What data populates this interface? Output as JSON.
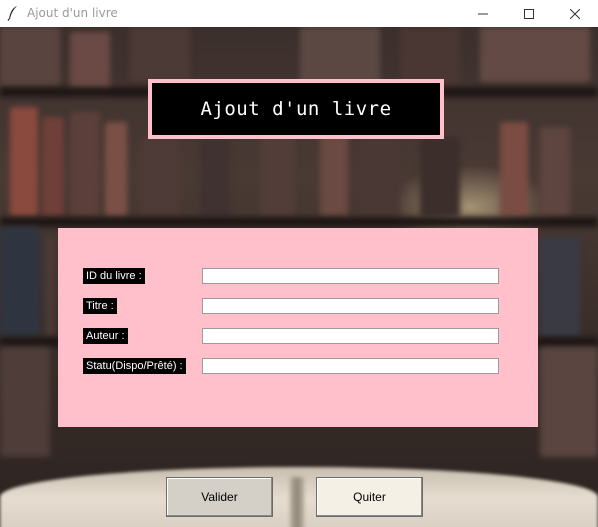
{
  "window": {
    "title": "Ajout d'un livre",
    "app_icon": "feather-icon",
    "controls": [
      "minimize-icon",
      "maximize-icon",
      "close-icon"
    ]
  },
  "heading": {
    "text": "Ajout d'un livre"
  },
  "form": {
    "fields": [
      {
        "label": "ID du livre :",
        "value": ""
      },
      {
        "label": "Titre :",
        "value": ""
      },
      {
        "label": "Auteur :",
        "value": ""
      },
      {
        "label": "Statu(Dispo/Prêté) :",
        "value": ""
      }
    ]
  },
  "buttons": {
    "validate_label": "Valider",
    "quit_label": "Quiter"
  },
  "colors": {
    "panel": "#ffc0cb",
    "heading_border": "#ffc0cb",
    "heading_bg": "#000000"
  }
}
